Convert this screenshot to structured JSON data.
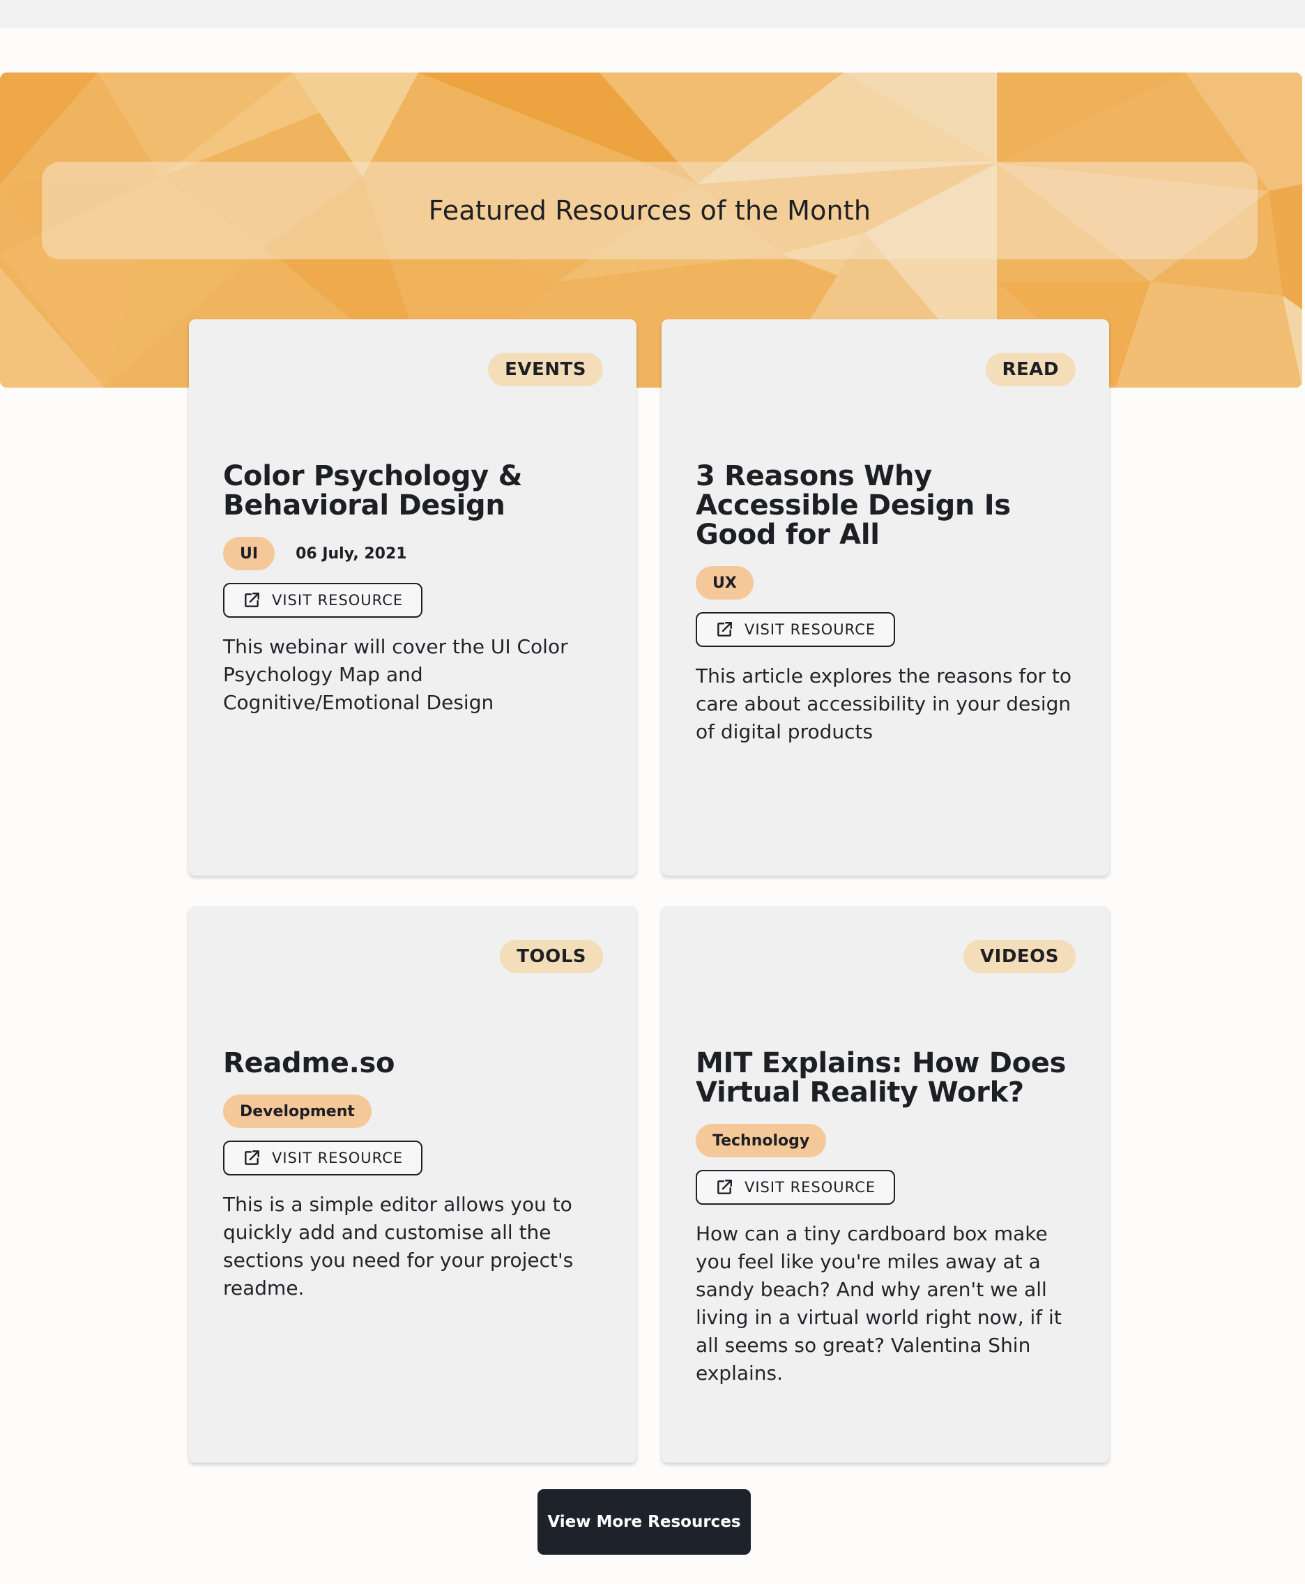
{
  "hero": {
    "title": "Featured Resources of the Month"
  },
  "cards": [
    {
      "category": "EVENTS",
      "title": "Color Psychology & Behavioral Design",
      "tag": "UI",
      "date": "06 July, 2021",
      "button_label": "VISIT RESOURCE",
      "description": "This webinar will cover the UI Color Psychology Map and Cognitive/Emotional Design"
    },
    {
      "category": "READ",
      "title": "3 Reasons Why Accessible Design Is Good for All",
      "tag": "UX",
      "button_label": "VISIT RESOURCE",
      "description": "This article explores the reasons for to care about accessibility in your design of digital products"
    },
    {
      "category": "TOOLS",
      "title": "Readme.so",
      "tag": "Development",
      "button_label": "VISIT RESOURCE",
      "description": "This is a simple editor allows you to quickly add and customise all the sections you need for your project's readme."
    },
    {
      "category": "VIDEOS",
      "title": "MIT Explains: How Does Virtual Reality Work?",
      "tag": "Technology",
      "button_label": "VISIT RESOURCE",
      "description": "How can a tiny cardboard box make you feel like you're miles away at a sandy beach? And why aren't we all living in a virtual world right now, if it all seems so great? Valentina Shin explains."
    }
  ],
  "more_button": {
    "label": "View More Resources"
  },
  "colors": {
    "hero_orange": "#f0b45e",
    "card_background": "#f0f0f0",
    "category_badge": "#f4ddb9",
    "tag_badge": "#f5c89a",
    "dark_button": "#1e222b"
  },
  "icons": {
    "visit_button_icon": "external-link-icon"
  }
}
